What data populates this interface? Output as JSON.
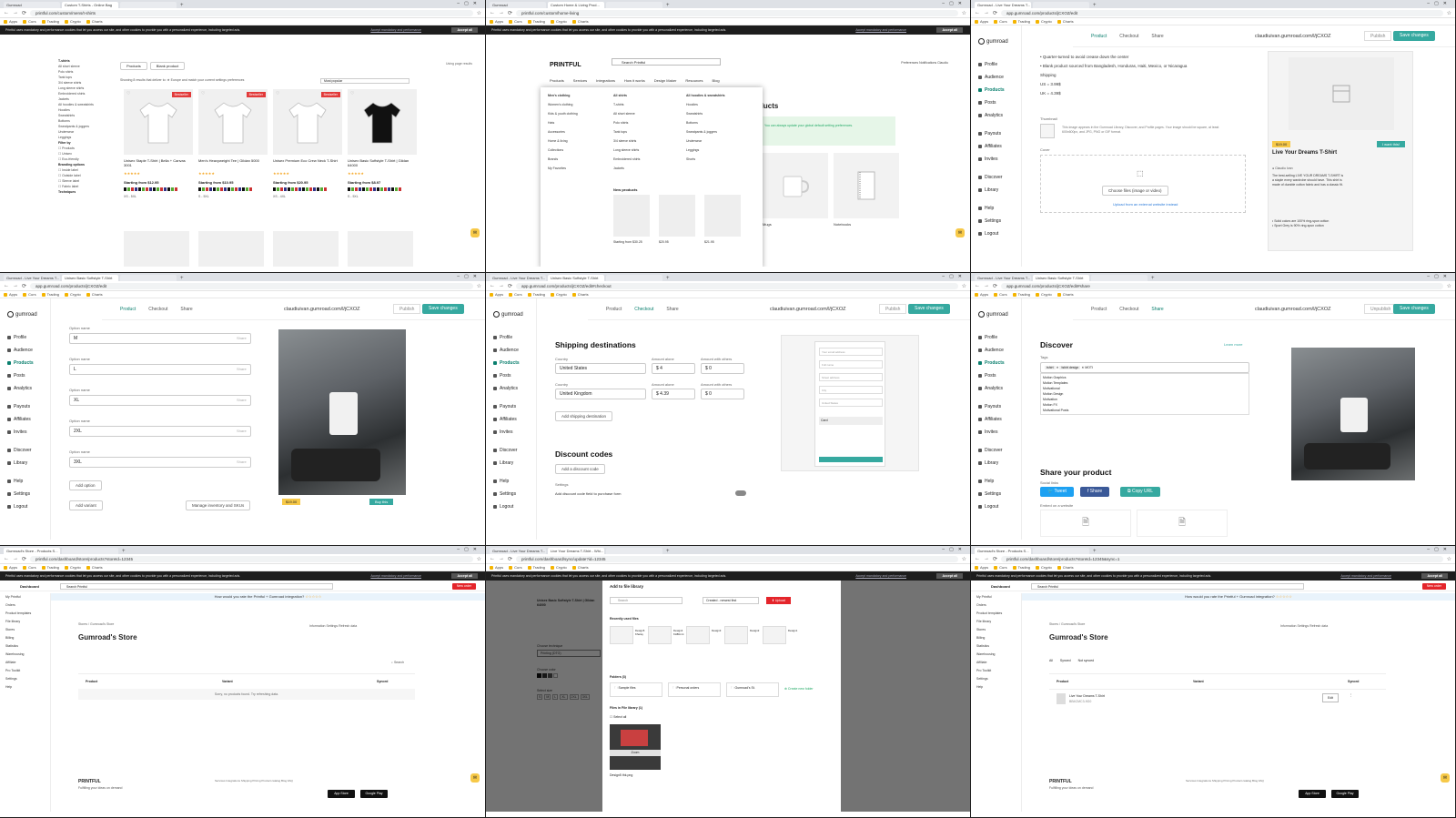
{
  "tiles": [
    {
      "tabs": [
        "Gumroad",
        "Custom T-Shirts - Online Bag",
        ""
      ],
      "url": "printful.com/custom/mens/t-shirts",
      "cookie_text": "Printful uses mandatory and performance cookies that let you access our site, and other cookies to provide you with a personalized experience, including targeted ads.",
      "cookie_link": "Accept mandatory and performance",
      "cookie_accept": "Accept all",
      "sidebar": {
        "title": "T-shirts",
        "items": [
          "All short sleeve",
          "Polo shirts",
          "Tank tops",
          "3/4 sleeve shirts",
          "Long sleeve shirts",
          "Embroidered shirts",
          "Jackets",
          "All hoodies & sweatshirts",
          "Hoodies",
          "Sweatshirts",
          "Bottoms",
          "Sweatpants & joggers",
          "Underwear",
          "Leggings"
        ],
        "filter_title": "Filter by",
        "filter_items": [
          "Products",
          "Unisex",
          "Eco-friendly"
        ],
        "branding_title": "Branding options",
        "branding_items": [
          "Inside label",
          "Outside label",
          "Sleeve label",
          "Fabric label"
        ],
        "techniques_title": "Techniques"
      },
      "toggle_tabs": [
        "Products",
        "Blank product"
      ],
      "sort_text": "Showing 8 results that deliver to: ★ Europe and match your current settings preferences",
      "sort_select": "Most popular",
      "using_pages": "Using page results",
      "products": [
        {
          "name": "Unisex Staple T-Shirt | Bella + Canvas 3001",
          "badge": "Bestseller",
          "price": "Starting from $12.95",
          "sizes": "XS - 5XL",
          "color": "#ffffff"
        },
        {
          "name": "Men's Heavyweight Tee | Gildan 5000",
          "badge": "Bestseller",
          "price": "Starting from $10.95",
          "sizes": "S - 5XL",
          "color": "#ffffff"
        },
        {
          "name": "Unisex Premium Eco Crew Neck T-Shirt",
          "badge": "Bestseller",
          "price": "Starting from $20.95",
          "sizes": "XS - 4XL",
          "color": "#ffffff"
        },
        {
          "name": "Unisex Basic Softstyle T-Shirt | Gildan 64000",
          "badge": "",
          "price": "Starting from $8.97",
          "sizes": "S - 5XL",
          "color": "#111111"
        }
      ],
      "status": "https://www.printful.com/custom/mens/t-shirts?product-id=12345"
    },
    {
      "tabs": [
        "Gumroad",
        "Custom Home & Living Prod...",
        ""
      ],
      "url": "printful.com/custom/home-living",
      "logo": "PRINTFUL",
      "search_placeholder": "Search Printful",
      "right_links": "Preferences   Notifications   Claudiu",
      "nav": [
        "Products",
        "Services",
        "Integrations",
        "How it works",
        "Design Maker",
        "Resources",
        "Blog"
      ],
      "menu": {
        "col1": [
          "Men's clothing",
          "Women's clothing",
          "Kids & youth clothing",
          "Hats",
          "Accessories",
          "Home & living",
          "Collections",
          "Brands",
          "My Favorites"
        ],
        "col2_title": "All shirts",
        "col2": [
          "T-shirts",
          "All short sleeve",
          "Polo shirts",
          "Tank tops",
          "3/4 sleeve shirts",
          "Long sleeve shirts",
          "Embroidered shirts",
          "Jackets"
        ],
        "col3_title": "All hoodies & sweatshirts",
        "col3": [
          "Hoodies",
          "Sweatshirts",
          "Bottoms",
          "Sweatpants & joggers",
          "Underwear",
          "Leggings",
          "Shorts"
        ],
        "new_title": "New products",
        "new_prices": [
          "Starting from $30.25",
          "$20.95",
          "$21.95"
        ]
      },
      "heading": "ducts",
      "banner": "You can always update your global default setting preferences.",
      "cat_labels": [
        "Mugs",
        "Notebooks"
      ],
      "status": "https://www.printful.com/custom/home-living"
    },
    {
      "tabs": [
        "Gumroad - Live Your Dreams T...",
        ""
      ],
      "url": "app.gumroad.com/products/jCXOZ/edit",
      "logo": "gumroad",
      "nav": [
        "Profile",
        "Audience",
        "Products",
        "Posts",
        "Analytics",
        "Payouts",
        "Affiliates",
        "Invites",
        "Discover",
        "Library",
        "Help",
        "Settings",
        "Logout"
      ],
      "tabs_inner": [
        "Product",
        "Checkout",
        "Share"
      ],
      "slug": "claudiuivan.gumroad.com/l/jCXOZ",
      "publish": "Publish",
      "save": "Save changes",
      "bullets": [
        "• Quarter-turned to avoid crease down the center",
        "• Blank product sourced from Bangladesh, Honduras, Haiti, Mexico, or Nicaragua"
      ],
      "shipping_label": "Shipping",
      "ship_us": "US = 3.99$",
      "ship_uk": "UK = 4.39$",
      "thumbnail_label": "Thumbnail",
      "thumbnail_hint": "This image appears in the Gumroad Library, Discover, and Profile pages. Your image should be square, at least 600x600px, and JPG, PNG or GIF format.",
      "cover_label": "Cover",
      "upload_btn": "Choose files (image or video)",
      "upload_link": "Upload from an external website instead",
      "preview_price": "$19.00",
      "preview_buy": "I want this!",
      "preview_title": "Live Your Dreams T-Shirt",
      "preview_author": "Claudiu Ivan",
      "preview_desc": "The best-selling LIVE YOUR DREAMS T-SHIRT is a staple every wardrobe should have. This shirt is made of durable cotton fabric and has a classic fit.",
      "preview_bullets": [
        "• Solid colors are 100% ring-spun cotton",
        "• Sport Grey is 90% ring-spun cotton"
      ]
    },
    {
      "tabs": [
        "Gumroad - Live Your Dreams T...",
        "Unisex Basic Softstyle T-Shirt",
        ""
      ],
      "url": "app.gumroad.com/products/jCXOZ/edit",
      "options": [
        {
          "label": "Option name",
          "value": "M"
        },
        {
          "label": "Option name",
          "value": "L"
        },
        {
          "label": "Option name",
          "value": "XL"
        },
        {
          "label": "Option name",
          "value": "2XL"
        },
        {
          "label": "Option name",
          "value": "3XL"
        }
      ],
      "share_label": "Share",
      "add_option": "Add option",
      "add_variant": "Add variant",
      "manage": "Manage inventory and SKUs",
      "price": "$19.00",
      "buy": "Buy this"
    },
    {
      "tabs": [
        "Gumroad - Live Your Dreams T...",
        "Unisex Basic Softstyle T-Shirt",
        ""
      ],
      "url": "app.gumroad.com/products/jCXOZ/edit#checkout",
      "shipping_title": "Shipping destinations",
      "country_label": "Country",
      "amount_alone": "Amount alone",
      "amount_others": "Amount with others",
      "rows": [
        {
          "country": "United States",
          "alone": "4",
          "others": "0"
        },
        {
          "country": "United Kingdom",
          "alone": "4.39",
          "others": "0"
        }
      ],
      "add_shipping": "Add shipping destination",
      "discount_title": "Discount codes",
      "add_discount": "Add a discount code",
      "settings_label": "Settings",
      "discount_field": "Add discount code field to purchase form",
      "preview_fields": [
        "Your email address",
        "Full name",
        "Street address",
        "City",
        "United States"
      ],
      "preview_card": "Card"
    },
    {
      "tabs": [
        "Gumroad - Live Your Dreams T...",
        "Unisex Basic Softstyle T-Shirt",
        ""
      ],
      "url": "app.gumroad.com/products/jCXOZ/edit#share",
      "unpublish": "Unpublish",
      "discover_title": "Discover",
      "learn_more": "Learn more",
      "tags_label": "Tags",
      "tags": [
        "tshirt",
        "tshirt design"
      ],
      "tag_input": "MOTI",
      "suggestions": [
        "Motion Graphics",
        "Motion Templates",
        "Motivational",
        "Motion Design",
        "Motivation",
        "Motion FX",
        "Motivational Posts"
      ],
      "share_title": "Share your product",
      "social_label": "Social links",
      "tweet": "Tweet",
      "share": "Share",
      "copy_url": "Copy URL",
      "embed_label": "Embed on a website"
    },
    {
      "tabs": [
        "Gumroad's Store - Products S...",
        ""
      ],
      "url": "printful.com/dashboard/store/products?storeId=12345",
      "dashboard": "Dashboard",
      "search": "Search Printful",
      "new_order": "New order",
      "rate": "How would you rate the Printful + Gumroad integration?",
      "side": [
        "My Printful",
        "Orders",
        "Product templates",
        "File library",
        "Stores",
        "Billing",
        "Statistics",
        "Warehousing",
        "Affiliate",
        "Pro Toolkit",
        "Settings",
        "Help"
      ],
      "breadcrumb": "Stores  /  Gumroad's Store",
      "title": "Gumroad's Store",
      "links": "Information   Settings   Refresh data",
      "search_small": "Search",
      "cols": [
        "Product",
        "Variant",
        "Synced"
      ],
      "empty": "Sorry, no products found. Try refreshing data.",
      "footer_logo": "PRINTFUL",
      "footer_tag": "Fulfilling your ideas on demand",
      "footer_links": "Services   Integrations   Shipping   Pricing   Product catalog   Blog   FAQ",
      "app_store": "App Store",
      "google_play": "Google Play",
      "status": "https://www.printful.com/dashboard/store/products"
    },
    {
      "tabs": [
        "Gumroad - Live Your Dreams T...",
        "Live Your Dreams T-Shirt - Whi...",
        ""
      ],
      "url": "printful.com/dashboard/sync/update?id=12345",
      "side_title": "Unisex Basic Softstyle T-Shirt | Gildan 64000",
      "choose_tech": "Choose technique",
      "printing": "Printing (DTG)",
      "choose_color": "Choose color",
      "select_size": "Select size",
      "sizes": [
        "S",
        "M",
        "L",
        "XL",
        "2XL",
        "3XL"
      ],
      "modal_title": "Add to file library",
      "modal_search": "Search",
      "sort": "Created - newest first",
      "upload": "Upload",
      "recent": "Recently used files",
      "recent_files": [
        "Design5 Kharay",
        "Design4 KHBrmnt",
        "Design3",
        "Design2",
        "Design1"
      ],
      "folders": "Folders (3)",
      "folder_names": [
        "Sample files",
        "Personal orders",
        "Gumroad's St."
      ],
      "create_folder": "Create new folder",
      "file_lib": "Files in File library (1)",
      "select_all": "Select all",
      "file_name": "Design5 thk.png",
      "file_tag": "Zoom"
    },
    {
      "tabs": [
        "Gumroad's Store - Products S...",
        ""
      ],
      "url": "printful.com/dashboard/store/products?storeId=12345&sync=1",
      "title": "Gumroad's Store",
      "filter_tabs": [
        "All",
        "Synced",
        "Not synced"
      ],
      "cols": [
        "Product",
        "Variant",
        "Synced"
      ],
      "product_row": "Live Your Dreams T-Shirt",
      "product_sub": "BB4CMC3-9G0",
      "edit": "Edit"
    }
  ],
  "colors": {
    "accent": "#36a9a0",
    "printful_red": "#e4252b",
    "tweet": "#1da1f2",
    "facebook": "#3b5998"
  }
}
